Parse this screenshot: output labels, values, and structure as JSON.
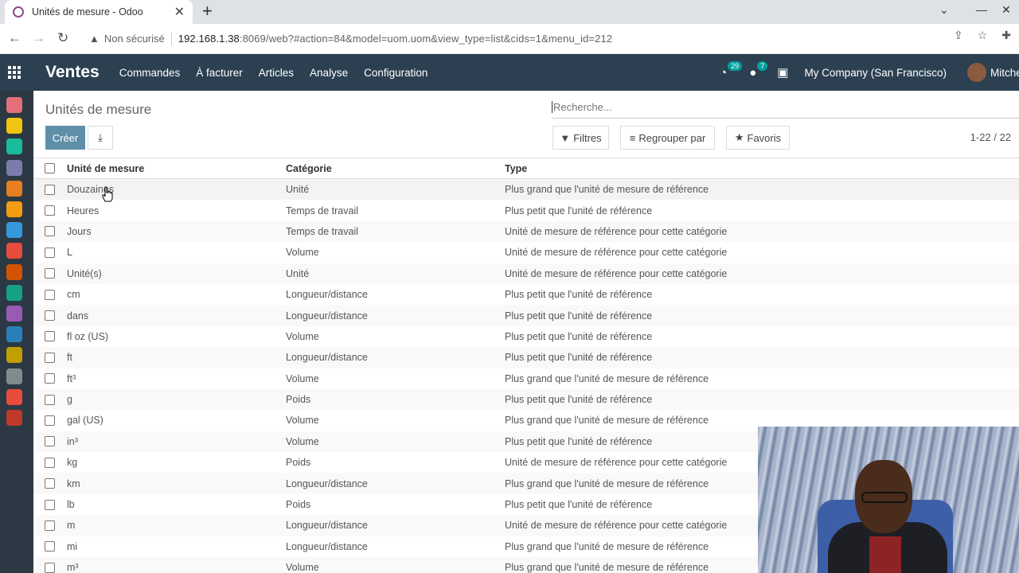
{
  "browser": {
    "tab_title": "Unités de mesure - Odoo",
    "security_label": "Non sécurisé",
    "url_host": "192.168.1.38",
    "url_rest": ":8069/web?#action=84&model=uom.uom&view_type=list&cids=1&menu_id=212"
  },
  "navbar": {
    "app_name": "Ventes",
    "menu": [
      "Commandes",
      "À facturer",
      "Articles",
      "Analyse",
      "Configuration"
    ],
    "activity_count": "29",
    "messages_count": "7",
    "company": "My Company (San Francisco)",
    "user": "Mitche"
  },
  "control_panel": {
    "title": "Unités de mesure",
    "search_placeholder": "Recherche...",
    "create_label": "Créer",
    "filters_label": "Filtres",
    "group_by_label": "Regrouper par",
    "favorites_label": "Favoris",
    "pager": "1-22 / 22"
  },
  "table": {
    "headers": [
      "Unité de mesure",
      "Catégorie",
      "Type"
    ],
    "rows": [
      {
        "name": "Douzaines",
        "category": "Unité",
        "type": "Plus grand que l'unité de mesure de référence"
      },
      {
        "name": "Heures",
        "category": "Temps de travail",
        "type": "Plus petit que l'unité de référence"
      },
      {
        "name": "Jours",
        "category": "Temps de travail",
        "type": "Unité de mesure de référence pour cette catégorie"
      },
      {
        "name": "L",
        "category": "Volume",
        "type": "Unité de mesure de référence pour cette catégorie"
      },
      {
        "name": "Unité(s)",
        "category": "Unité",
        "type": "Unité de mesure de référence pour cette catégorie"
      },
      {
        "name": "cm",
        "category": "Longueur/distance",
        "type": "Plus petit que l'unité de référence"
      },
      {
        "name": "dans",
        "category": "Longueur/distance",
        "type": "Plus petit que l'unité de référence"
      },
      {
        "name": "fl oz (US)",
        "category": "Volume",
        "type": "Plus petit que l'unité de référence"
      },
      {
        "name": "ft",
        "category": "Longueur/distance",
        "type": "Plus petit que l'unité de référence"
      },
      {
        "name": "ft³",
        "category": "Volume",
        "type": "Plus grand que l'unité de mesure de référence"
      },
      {
        "name": "g",
        "category": "Poids",
        "type": "Plus petit que l'unité de référence"
      },
      {
        "name": "gal (US)",
        "category": "Volume",
        "type": "Plus grand que l'unité de mesure de référence"
      },
      {
        "name": "in³",
        "category": "Volume",
        "type": "Plus petit que l'unité de référence"
      },
      {
        "name": "kg",
        "category": "Poids",
        "type": "Unité de mesure de référence pour cette catégorie"
      },
      {
        "name": "km",
        "category": "Longueur/distance",
        "type": "Plus grand que l'unité de mesure de référence"
      },
      {
        "name": "lb",
        "category": "Poids",
        "type": "Plus petit que l'unité de référence"
      },
      {
        "name": "m",
        "category": "Longueur/distance",
        "type": "Unité de mesure de référence pour cette catégorie"
      },
      {
        "name": "mi",
        "category": "Longueur/distance",
        "type": "Plus grand que l'unité de mesure de référence"
      },
      {
        "name": "m³",
        "category": "Volume",
        "type": "Plus grand que l'unité de mesure de référence"
      }
    ]
  },
  "sidebar_apps": [
    {
      "icon": "discuss-icon",
      "color": "#e46f78"
    },
    {
      "icon": "calendar-icon",
      "color": "#f1c40f"
    },
    {
      "icon": "contacts-icon",
      "color": "#1abc9c"
    },
    {
      "icon": "crm-icon",
      "color": "#7c7bad"
    },
    {
      "icon": "sales-icon",
      "color": "#e67e22"
    },
    {
      "icon": "website-icon",
      "color": "#f39c12"
    },
    {
      "icon": "invoicing-icon",
      "color": "#3498db"
    },
    {
      "icon": "inventory-icon",
      "color": "#e74c3c"
    },
    {
      "icon": "documents-icon",
      "color": "#d35400"
    },
    {
      "icon": "discuss-channel-icon",
      "color": "#16a085"
    },
    {
      "icon": "apps-icon",
      "color": "#9b59b6"
    },
    {
      "icon": "employees-icon",
      "color": "#2980b9"
    },
    {
      "icon": "expenses-icon",
      "color": "#c0a000"
    },
    {
      "icon": "settings-icon",
      "color": "#7f8c8d"
    },
    {
      "icon": "dashboard-icon",
      "color": "#e74c3c"
    },
    {
      "icon": "tools-icon",
      "color": "#c0392b"
    }
  ],
  "colors": {
    "navbar": "#2c4052",
    "create_button": "#5f8fa8",
    "sidebar": "#2c3945"
  }
}
